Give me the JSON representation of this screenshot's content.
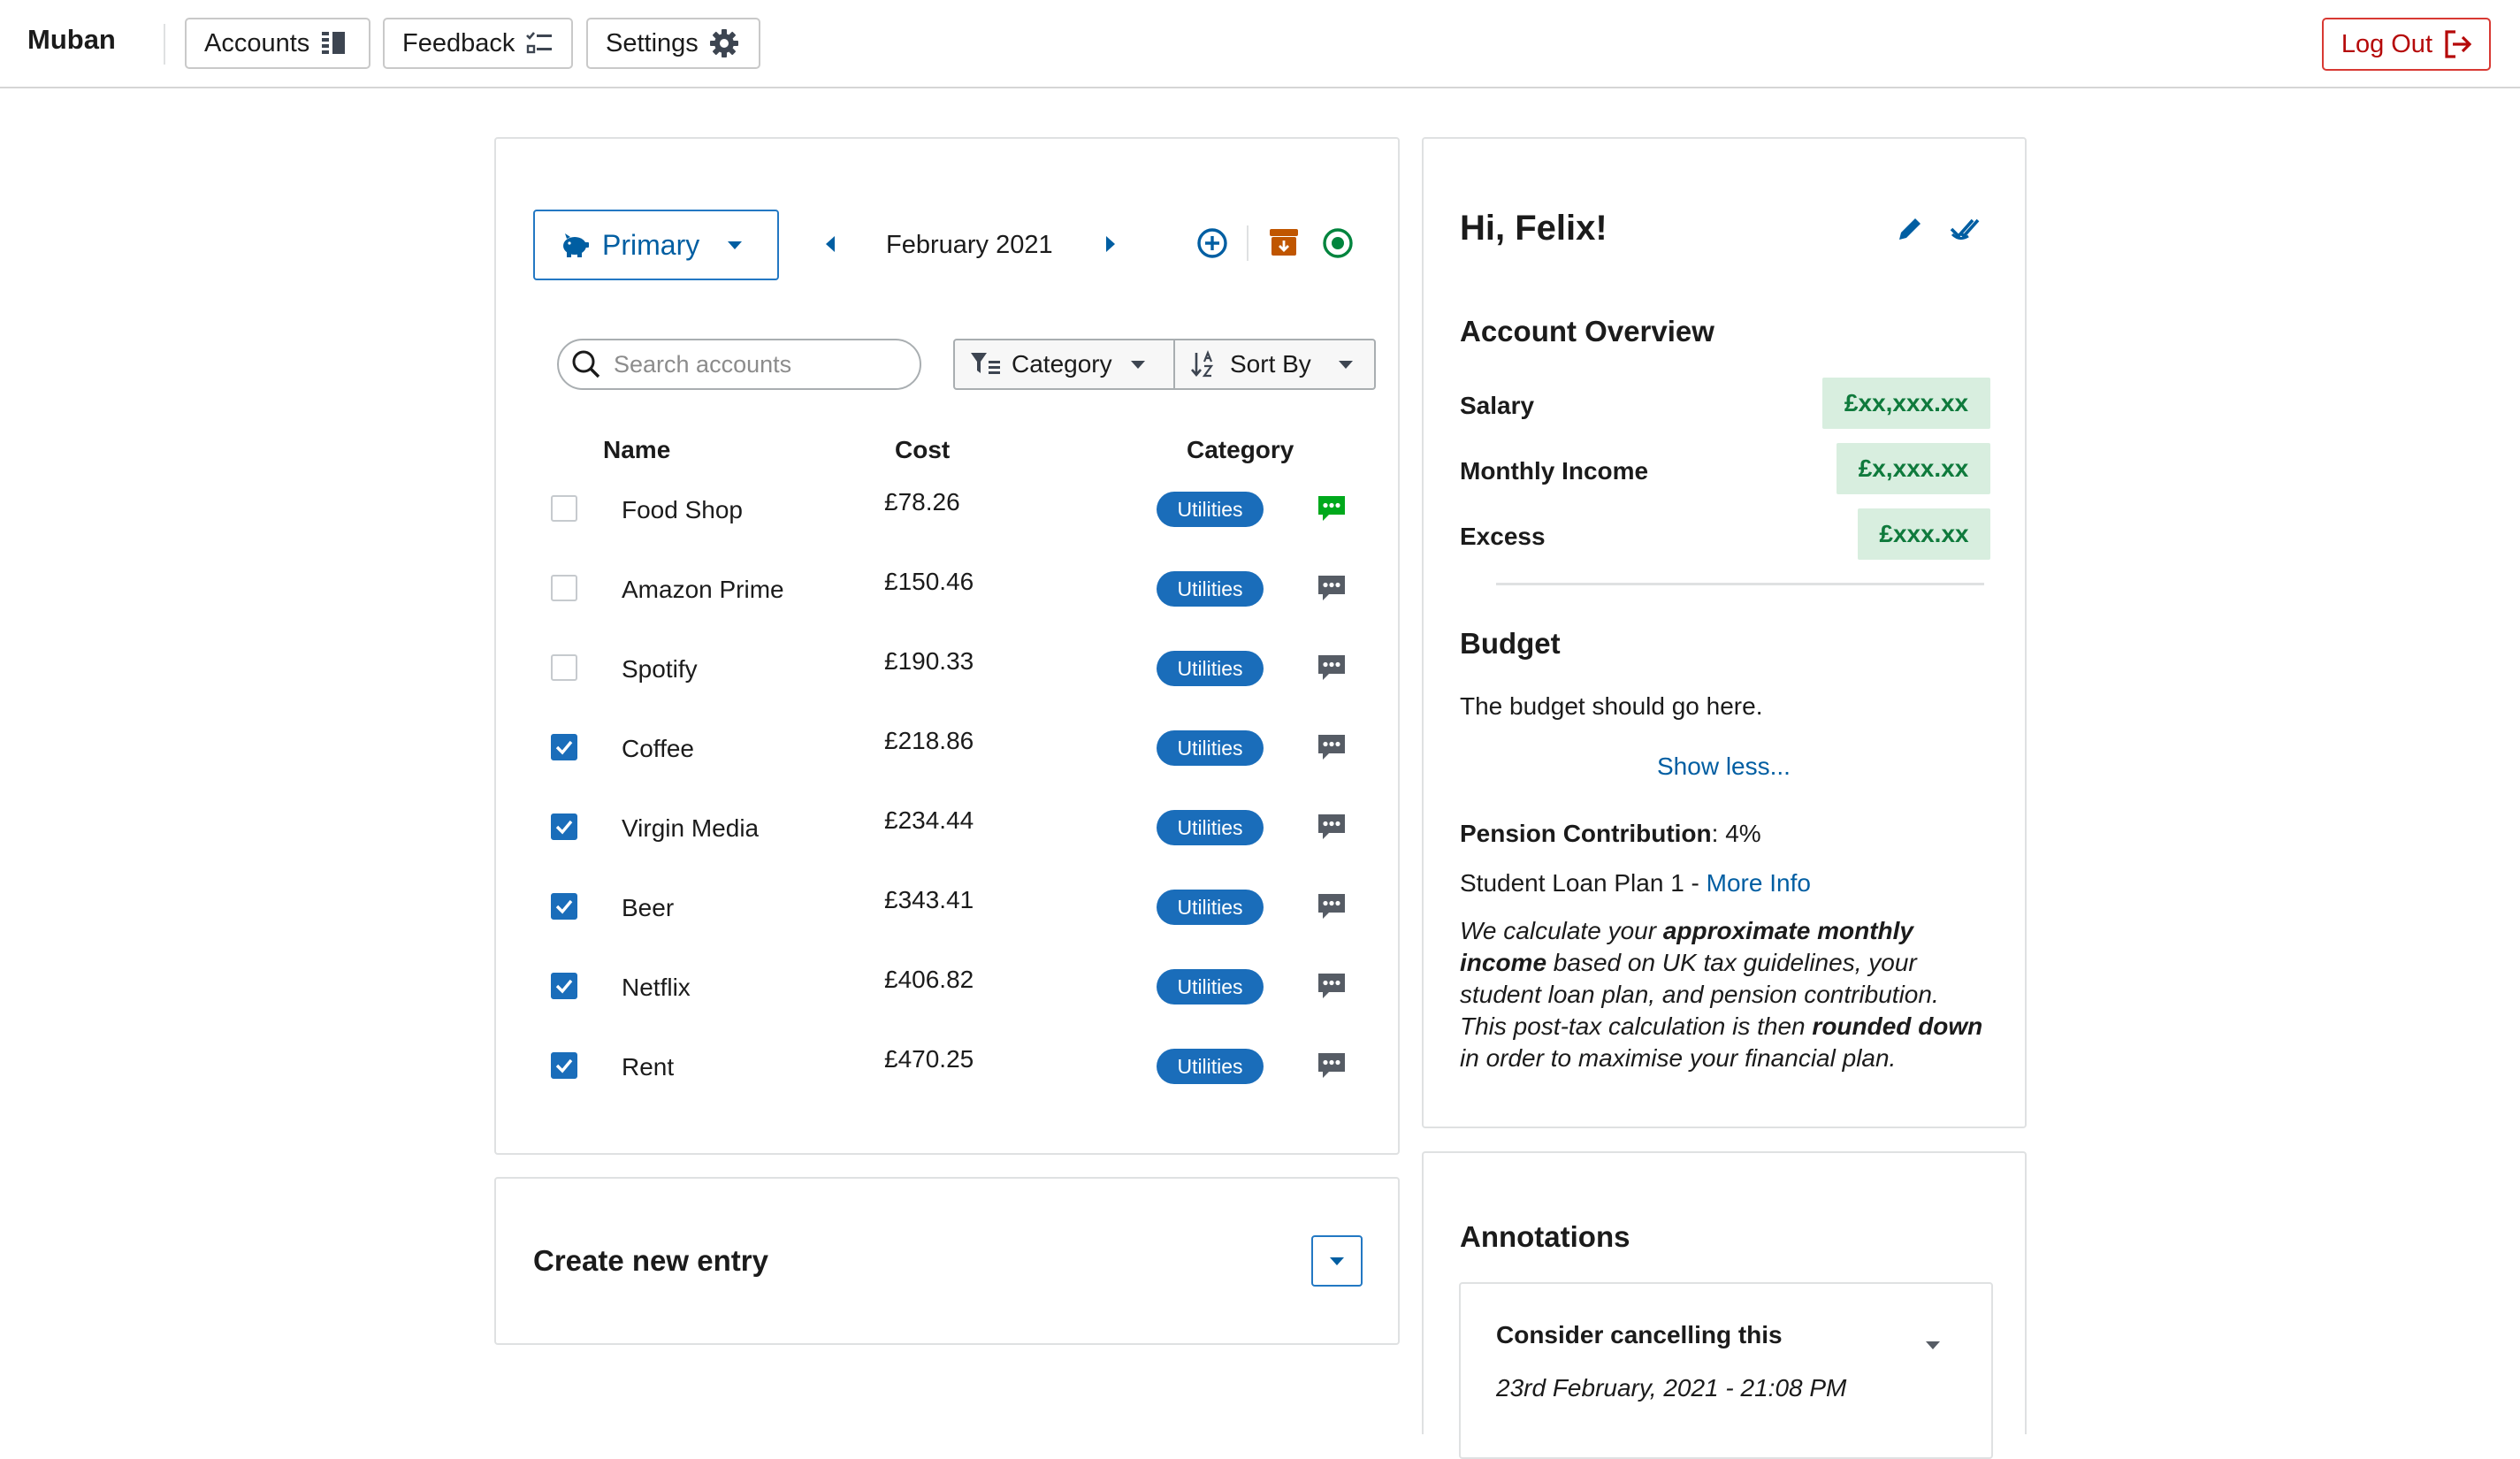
{
  "nav": {
    "brand": "Muban",
    "accounts_label": "Accounts",
    "feedback_label": "Feedback",
    "settings_label": "Settings",
    "logout_label": "Log Out"
  },
  "budget_card": {
    "account_select": "Primary",
    "month": "February 2021",
    "search_placeholder": "Search accounts",
    "category_filter": "Category",
    "sort_by": "Sort By",
    "columns": {
      "name": "Name",
      "cost": "Cost",
      "category": "Category"
    },
    "rows": [
      {
        "name": "Food Shop",
        "cost": "£78.26",
        "category": "Utilities",
        "checked": false,
        "has_comment": true
      },
      {
        "name": "Amazon Prime",
        "cost": "£150.46",
        "category": "Utilities",
        "checked": false,
        "has_comment": false
      },
      {
        "name": "Spotify",
        "cost": "£190.33",
        "category": "Utilities",
        "checked": false,
        "has_comment": false
      },
      {
        "name": "Coffee",
        "cost": "£218.86",
        "category": "Utilities",
        "checked": true,
        "has_comment": false
      },
      {
        "name": "Virgin Media",
        "cost": "£234.44",
        "category": "Utilities",
        "checked": true,
        "has_comment": false
      },
      {
        "name": "Beer",
        "cost": "£343.41",
        "category": "Utilities",
        "checked": true,
        "has_comment": false
      },
      {
        "name": "Netflix",
        "cost": "£406.82",
        "category": "Utilities",
        "checked": true,
        "has_comment": false
      },
      {
        "name": "Rent",
        "cost": "£470.25",
        "category": "Utilities",
        "checked": true,
        "has_comment": false
      }
    ]
  },
  "create_card": {
    "title": "Create new entry"
  },
  "profile": {
    "greeting": "Hi, Felix!",
    "overview_title": "Account Overview",
    "salary_label": "Salary",
    "salary_value": "£xx,xxx.xx",
    "income_label": "Monthly Income",
    "income_value": "£x,xxx.xx",
    "excess_label": "Excess",
    "excess_value": "£xxx.xx",
    "budget_title": "Budget",
    "budget_text": "The budget should go here.",
    "show_less": "Show less...",
    "pension_label": "Pension Contribution",
    "pension_value": ": 4%",
    "loan_text": "Student Loan Plan 1 - ",
    "more_info": "More Info",
    "note": {
      "p1": "We calculate your ",
      "b1": "approximate monthly income",
      "p2": " based on UK tax guidelines, your student loan plan, and pension contribution. This post-tax calculation is then ",
      "b2": "rounded down",
      "p3": " in order to maximise your financial plan."
    }
  },
  "annotations": {
    "title": "Annotations",
    "item_title": "Consider cancelling this",
    "item_date": "23rd February, 2021 - 21:08 PM"
  },
  "colors": {
    "primary": "#005ea2",
    "tag": "#1a6dba",
    "danger": "#b50909",
    "success_bg": "#d8eedf",
    "success_text": "#0f7a3c",
    "archive": "#c05600",
    "comment_active": "#00a91c",
    "comment_default": "#565c65"
  },
  "icons": {
    "accounts": "columns-icon",
    "feedback": "checklist-icon",
    "settings": "gear-icon",
    "logout": "logout-icon",
    "account_select": "piggy-bank-icon",
    "add": "add-circle-icon",
    "archive": "archive-icon",
    "record": "record-icon",
    "edit": "pencil-icon",
    "check": "double-check-icon"
  }
}
